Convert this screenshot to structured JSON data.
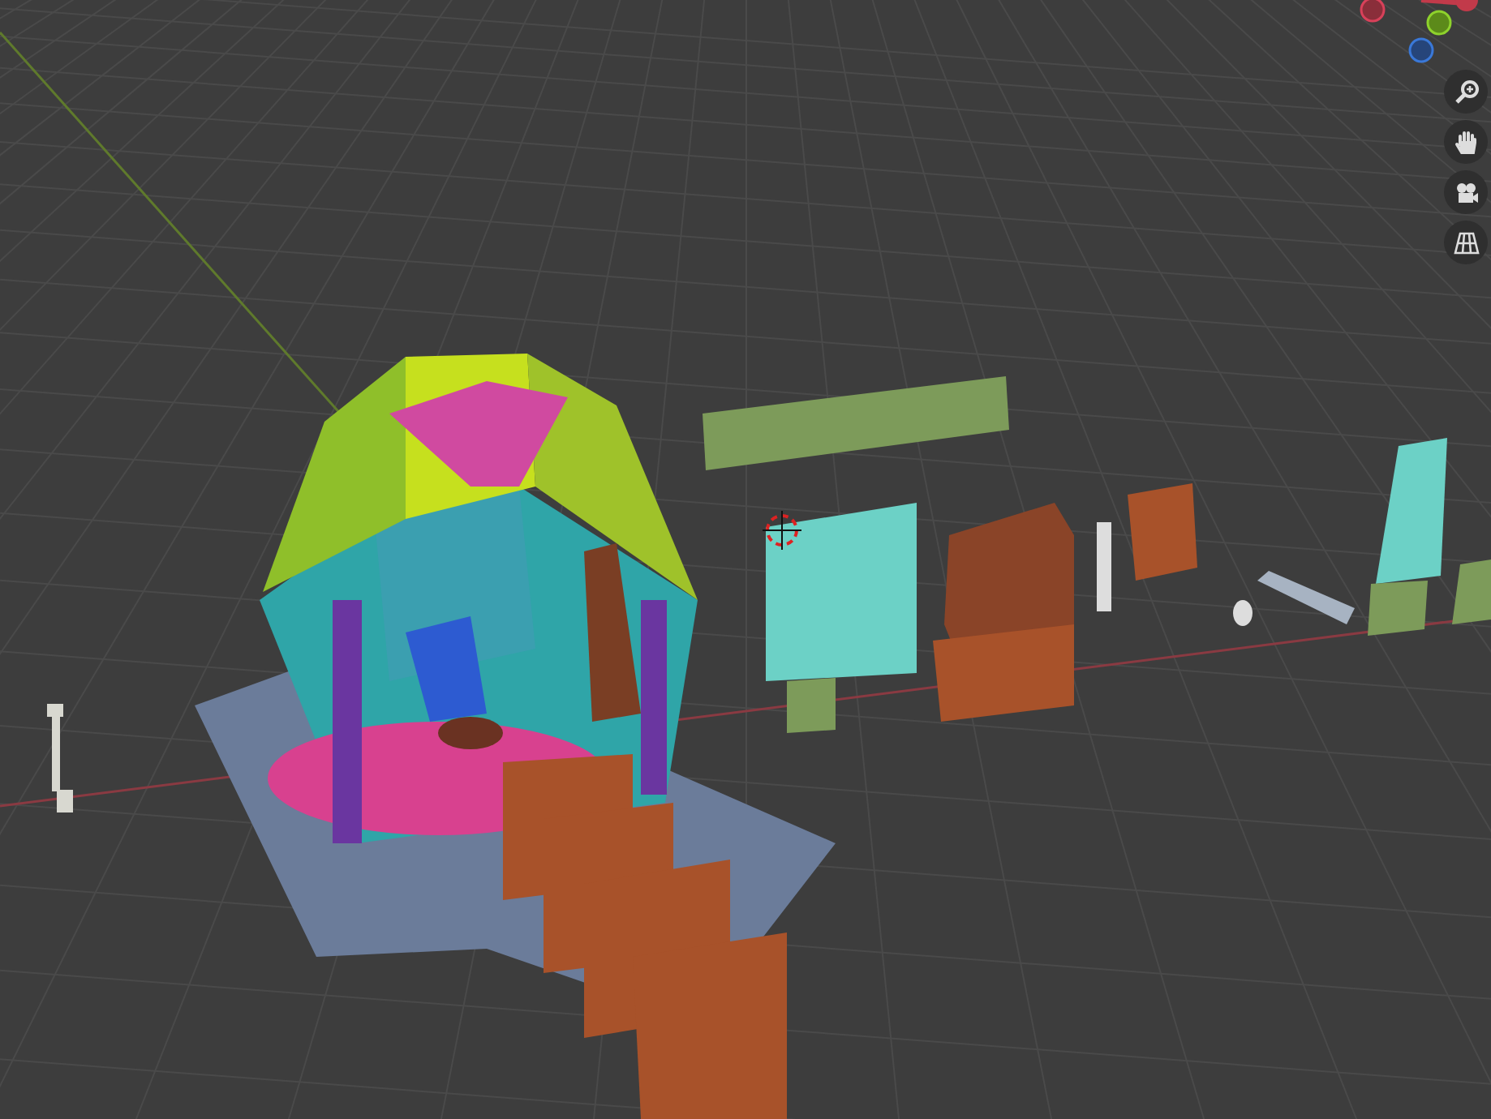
{
  "viewport": {
    "navigation_tools": [
      {
        "kind": "zoom"
      },
      {
        "kind": "pan"
      },
      {
        "kind": "camera"
      },
      {
        "kind": "ortho"
      }
    ]
  }
}
